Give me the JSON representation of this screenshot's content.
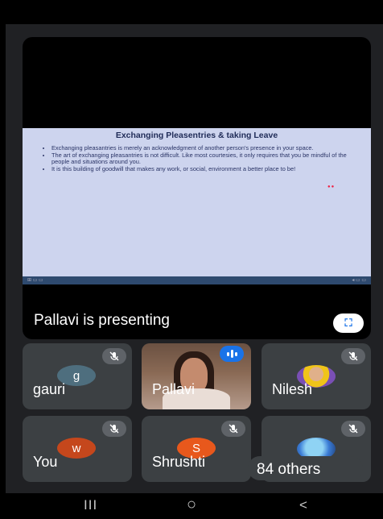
{
  "slide": {
    "title": "Exchanging Pleasentries & taking Leave",
    "bullets": [
      "Exchanging pleasantries is merely an acknowledgment of another person's presence in your space.",
      "The art of exchanging pleasantries is not difficult. Like most courtesies, it only requires that you be mindful of the people and situations around you.",
      "It is this building of goodwill that makes any work, or social, environment a better place to be!"
    ]
  },
  "presenting_label": "Pallavi is presenting",
  "participants": [
    {
      "name": "gauri",
      "initial": "g",
      "avatar_color": "#4e6e7e"
    },
    {
      "name": "Pallavi",
      "speaking": true
    },
    {
      "name": "Nilesh"
    },
    {
      "name": "You",
      "initial": "w",
      "avatar_color": "#c5471c"
    },
    {
      "name": "Shrushti",
      "initial": "S",
      "avatar_color": "#e8581c"
    }
  ],
  "others_label": "84 others",
  "icons": [
    "mic-off-icon",
    "audio-level-icon",
    "fullscreen-icon",
    "recents-icon",
    "home-icon",
    "back-icon"
  ],
  "colors": {
    "accent": "#1a73e8",
    "tile": "#3c4043",
    "background": "#202124"
  },
  "nav": {
    "recents": "III",
    "home": "○",
    "back": "<"
  }
}
